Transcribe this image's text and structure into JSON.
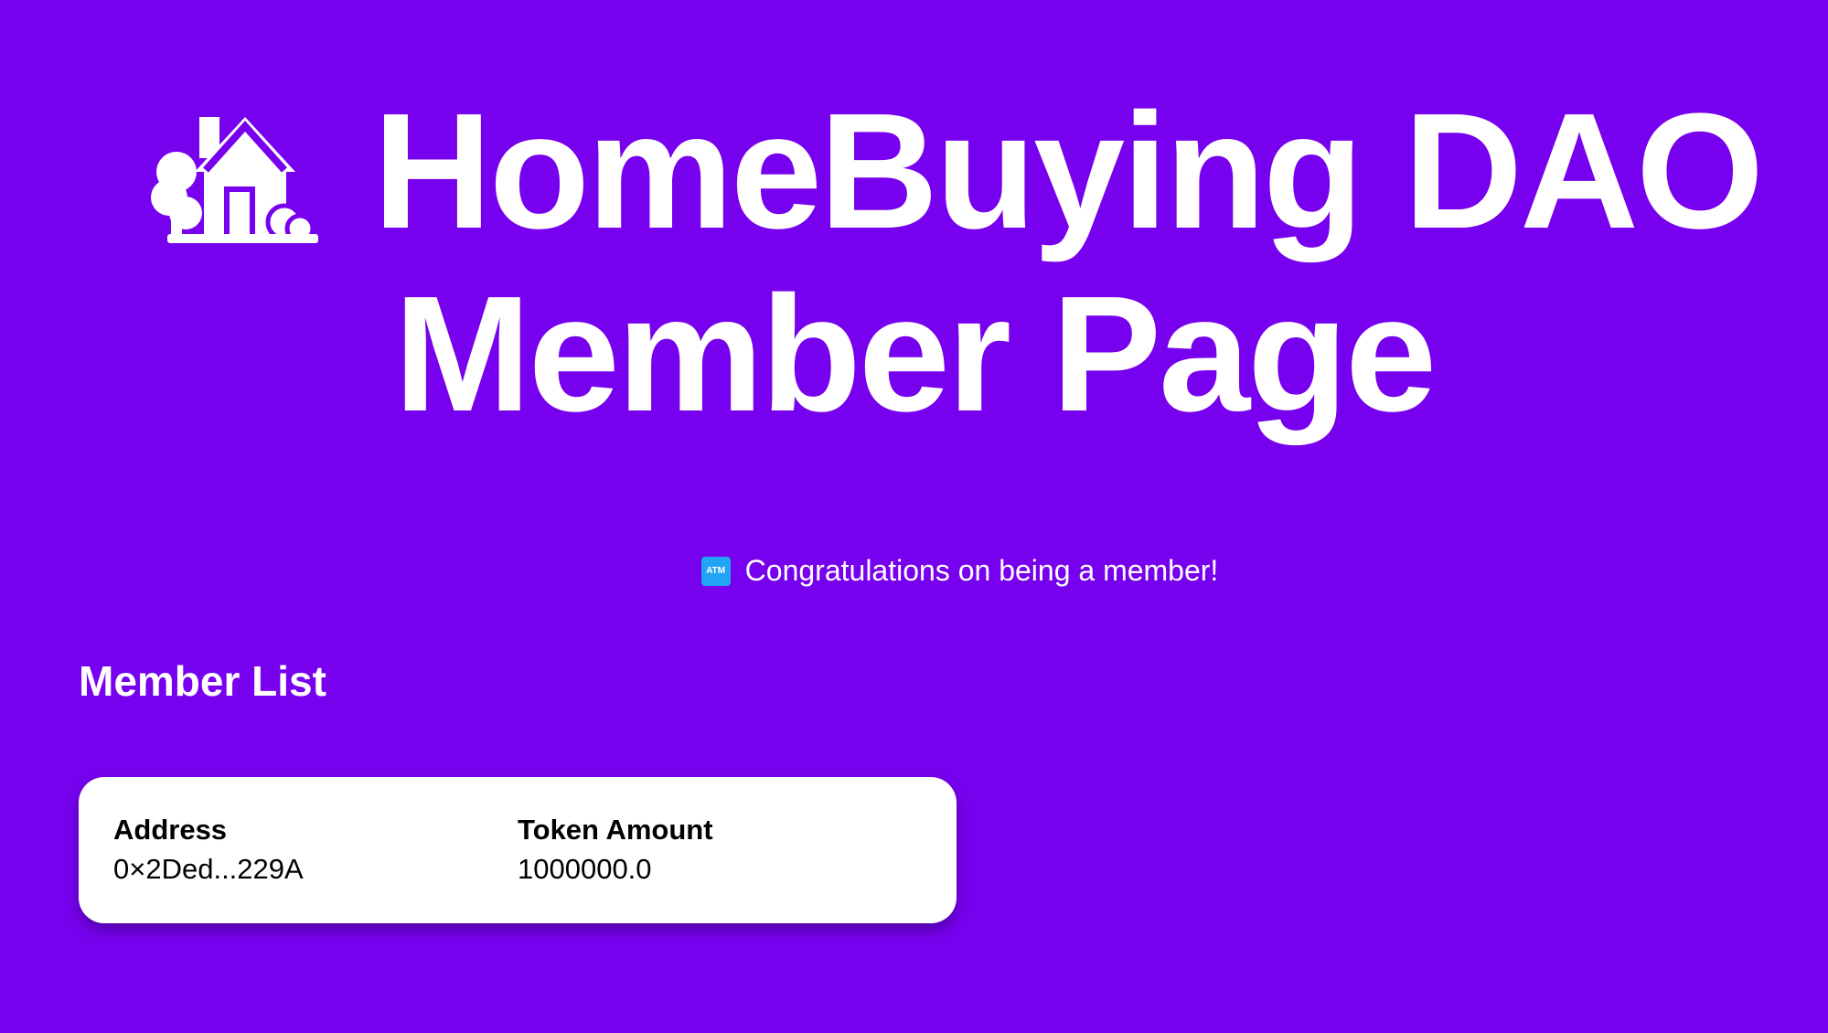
{
  "header": {
    "title_line1": "HomeBuying DAO",
    "title_line2": "Member Page",
    "icon": "house-with-garden-icon"
  },
  "notice": {
    "icon": "atm-icon",
    "icon_text": "ATM",
    "text": "Congratulations on being a member!"
  },
  "member_list": {
    "title": "Member List",
    "columns": [
      "Address",
      "Token Amount"
    ],
    "rows": [
      {
        "address": "0×2Ded...229A",
        "token_amount": "1000000.0"
      }
    ]
  },
  "colors": {
    "background": "#7700ee",
    "text": "#ffffff",
    "card": "#ffffff",
    "atm_icon": "#20a4f3"
  }
}
